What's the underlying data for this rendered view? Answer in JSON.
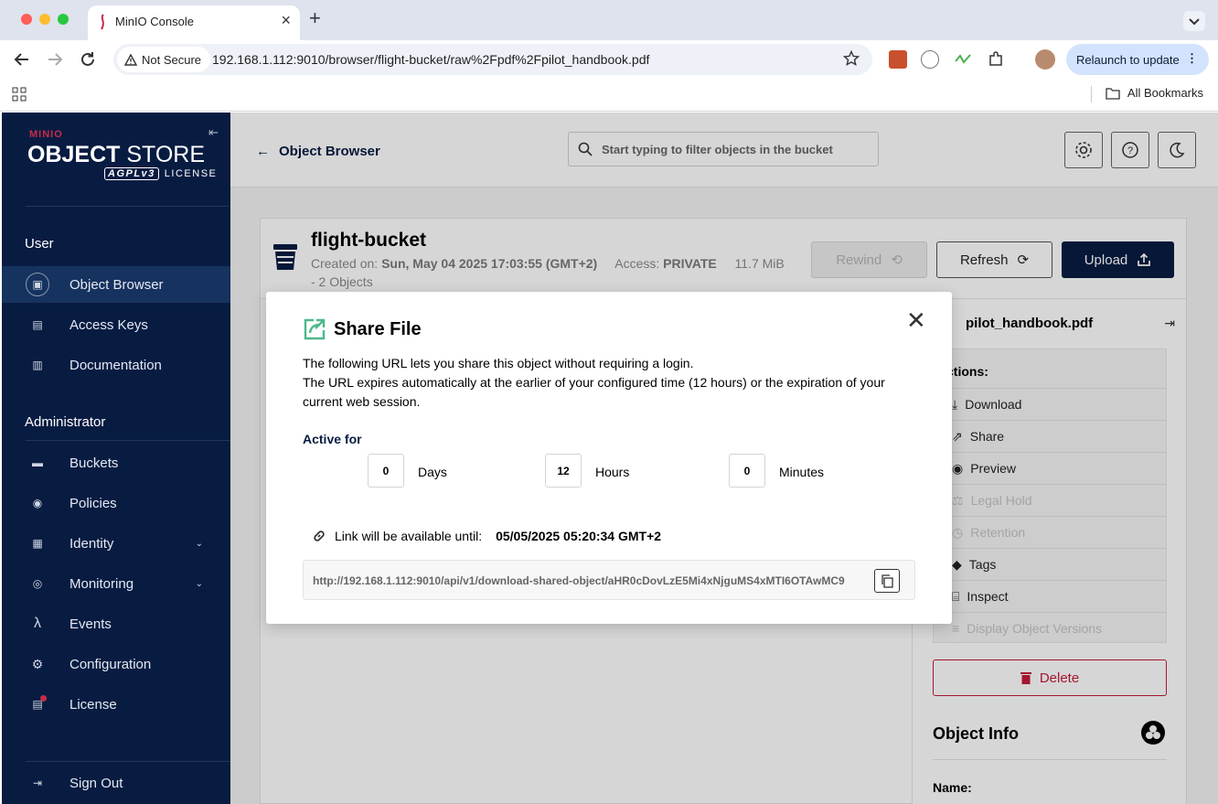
{
  "browser": {
    "tab_title": "MinIO Console",
    "security_label": "Not Secure",
    "url": "192.168.1.112:9010/browser/flight-bucket/raw%2Fpdf%2Fpilot_handbook.pdf",
    "relaunch_label": "Relaunch to update",
    "all_bookmarks": "All Bookmarks"
  },
  "sidebar": {
    "logo_top": "MINIO",
    "logo_main_bold": "OBJECT",
    "logo_main_light": " STORE",
    "logo_badge": "AGPLv3",
    "logo_license": "LICENSE",
    "user_section": "User",
    "user_items": [
      {
        "label": "Object Browser",
        "icon": "object-browser-icon"
      },
      {
        "label": "Access Keys",
        "icon": "key-icon"
      },
      {
        "label": "Documentation",
        "icon": "document-icon"
      }
    ],
    "admin_section": "Administrator",
    "admin_items": [
      {
        "label": "Buckets",
        "icon": "bucket-icon"
      },
      {
        "label": "Policies",
        "icon": "shield-icon"
      },
      {
        "label": "Identity",
        "icon": "id-card-icon"
      },
      {
        "label": "Monitoring",
        "icon": "monitoring-icon"
      },
      {
        "label": "Events",
        "icon": "lambda-icon"
      },
      {
        "label": "Configuration",
        "icon": "gear-icon"
      },
      {
        "label": "License",
        "icon": "license-icon"
      }
    ],
    "sign_out": "Sign Out"
  },
  "topbar": {
    "back_label": "Object Browser",
    "filter_placeholder": "Start typing to filter objects in the bucket"
  },
  "bucket": {
    "name": "flight-bucket",
    "created_label": "Created on:",
    "created_value": "Sun, May 04 2025 17:03:55 (GMT+2)",
    "access_label": "Access:",
    "access_value": "PRIVATE",
    "size": "11.7 MiB",
    "objects": "- 2 Objects",
    "rewind_label": "Rewind",
    "refresh_label": "Refresh",
    "upload_label": "Upload"
  },
  "details": {
    "file_name": "pilot_handbook.pdf",
    "actions_title": "ctions:",
    "actions": [
      {
        "label": "Download",
        "icon": "download-icon",
        "enabled": true
      },
      {
        "label": "Share",
        "icon": "share-icon",
        "enabled": true
      },
      {
        "label": "Preview",
        "icon": "eye-icon",
        "enabled": true
      },
      {
        "label": "Legal Hold",
        "icon": "legal-hold-icon",
        "enabled": false
      },
      {
        "label": "Retention",
        "icon": "retention-icon",
        "enabled": false
      },
      {
        "label": "Tags",
        "icon": "tag-icon",
        "enabled": true
      },
      {
        "label": "Inspect",
        "icon": "inspect-icon",
        "enabled": true
      },
      {
        "label": "Display Object Versions",
        "icon": "versions-icon",
        "enabled": false
      }
    ],
    "delete_label": "Delete",
    "object_info_title": "Object Info",
    "name_label": "Name:"
  },
  "modal": {
    "title": "Share File",
    "desc_line1": "The following URL lets you share this object without requiring a login.",
    "desc_line2": "The URL expires automatically at the earlier of your configured time (12 hours) or the expiration of your current web session.",
    "active_for_label": "Active for",
    "days_value": "0",
    "days_label": "Days",
    "hours_value": "12",
    "hours_label": "Hours",
    "minutes_value": "0",
    "minutes_label": "Minutes",
    "available_label": "Link will be available until:",
    "available_date": "05/05/2025 05:20:34 GMT+2",
    "share_url": "http://192.168.1.112:9010/api/v1/download-shared-object/aHR0cDovLzE5Mi4xNjguMS4xMTI6OTAwMC9"
  },
  "colors": {
    "sidebar_bg": "#081c42",
    "accent_green": "#4cb98a",
    "danger": "#c51b3a"
  }
}
